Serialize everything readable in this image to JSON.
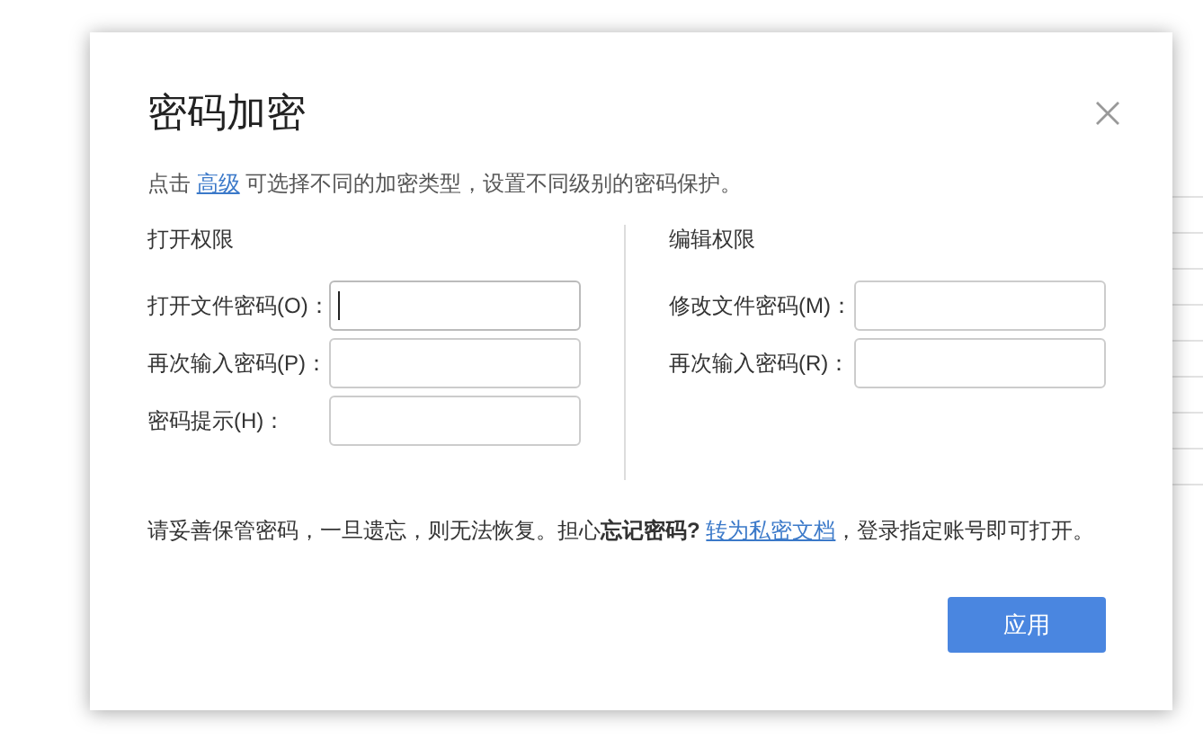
{
  "dialog": {
    "title": "密码加密",
    "hint": {
      "before": "点击 ",
      "link": "高级",
      "after": " 可选择不同的加密类型，设置不同级别的密码保护。"
    },
    "sections": [
      {
        "heading": "打开权限",
        "fields": [
          {
            "label": "打开文件密码(O)：",
            "focused": true
          },
          {
            "label": "再次输入密码(P)：",
            "focused": false
          },
          {
            "label": "密码提示(H)：",
            "focused": false
          }
        ]
      },
      {
        "heading": "编辑权限",
        "fields": [
          {
            "label": "修改文件密码(M)：",
            "focused": false
          },
          {
            "label": "再次输入密码(R)：",
            "focused": false
          }
        ]
      }
    ],
    "note": {
      "before": "请妥善保管密码，一旦遗忘，则无法恢复。担心**忘记密码?** ",
      "link": "转为私密文档",
      "after": "，登录指定账号即可打开。"
    },
    "apply_button": "应用"
  }
}
